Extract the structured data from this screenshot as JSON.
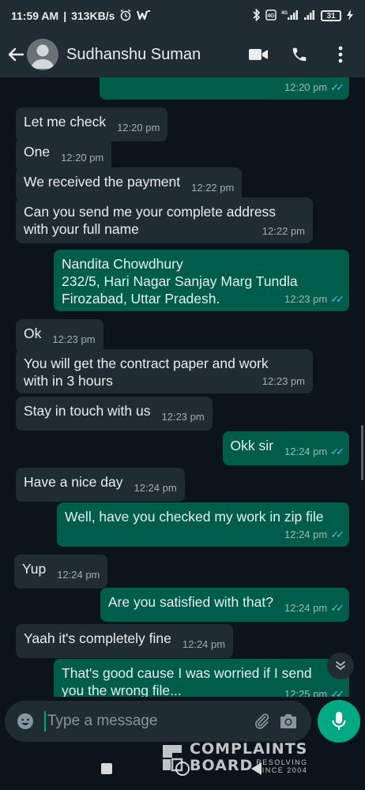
{
  "status_bar": {
    "time": "11:59 AM",
    "speed": "313KB/s",
    "alarm_icon": "alarm-icon",
    "app_icon": "w-icon",
    "network": "4G",
    "battery": "31"
  },
  "header": {
    "contact_name": "Sudhanshu Suman",
    "icons": [
      "back-arrow-icon",
      "avatar-icon",
      "video-call-icon",
      "phone-icon",
      "more-vert-icon"
    ]
  },
  "messages": [
    {
      "dir": "out",
      "text": "",
      "time": "12:20 pm",
      "ticks": true
    },
    {
      "dir": "in",
      "text": "Let me check",
      "time": "12:20 pm"
    },
    {
      "dir": "in",
      "text": "One",
      "time": "12:20 pm"
    },
    {
      "dir": "in",
      "text": "We received the payment",
      "time": "12:22 pm"
    },
    {
      "dir": "in",
      "text": "Can you send me your complete address\nwith your full name",
      "time": "12:22 pm"
    },
    {
      "dir": "out",
      "text": "Nandita Chowdhury\n232/5, Hari Nagar Sanjay Marg Tundla\nFirozabad, Uttar Pradesh.",
      "time": "12:23 pm",
      "ticks": true
    },
    {
      "dir": "in",
      "text": "Ok",
      "time": "12:23 pm"
    },
    {
      "dir": "in",
      "text": "You will get the contract paper and work\nwith in 3 hours",
      "time": "12:23 pm"
    },
    {
      "dir": "in",
      "text": "Stay in touch with us",
      "time": "12:23 pm"
    },
    {
      "dir": "out",
      "text": "Okk sir",
      "time": "12:24 pm",
      "ticks": true
    },
    {
      "dir": "in",
      "text": "Have a nice day",
      "time": "12:24 pm"
    },
    {
      "dir": "out",
      "text": "Well, have you checked my work in zip file",
      "time": "12:24 pm",
      "ticks": true
    },
    {
      "dir": "in",
      "text": "Yup",
      "time": "12:24 pm"
    },
    {
      "dir": "out",
      "text": "Are you satisfied with that?",
      "time": "12:24 pm",
      "ticks": true
    },
    {
      "dir": "in",
      "text": "Yaah it's completely fine",
      "time": "12:24 pm"
    },
    {
      "dir": "out",
      "text": "That's good cause I was worried if I send\nyou the wrong file...",
      "time": "12:25 pm",
      "ticks": true
    }
  ],
  "input": {
    "placeholder": "Type a message"
  },
  "watermark": {
    "line1": "COMPLAINTS",
    "line2": "BOARD",
    "small1": "RESOLVING",
    "small2": "SINCE 2004"
  },
  "colors": {
    "header_bg": "#1f2c34",
    "chat_bg": "#0b141a",
    "incoming_bubble": "#1f2c34",
    "outgoing_bubble": "#005c4b",
    "accent": "#00a884",
    "read_ticks": "#53bdeb"
  }
}
